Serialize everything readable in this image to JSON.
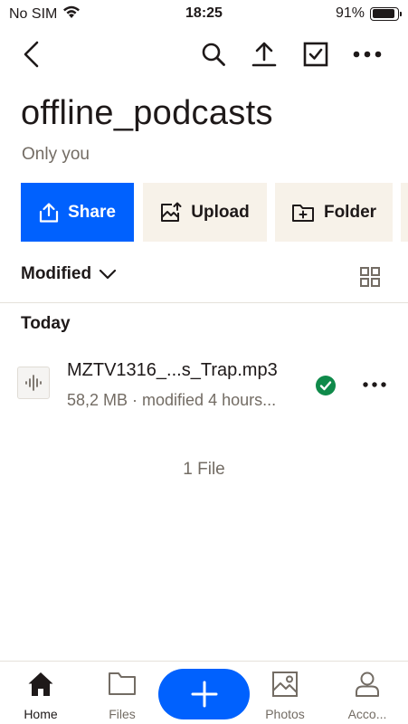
{
  "status_bar": {
    "carrier": "No SIM",
    "time": "18:25",
    "battery": "91%",
    "battery_level": 0.91
  },
  "toolbar": {
    "icons": [
      "back-icon",
      "search-icon",
      "upload-icon",
      "select-icon",
      "more-icon"
    ]
  },
  "header": {
    "title": "offline_podcasts",
    "subtitle": "Only you"
  },
  "actions": {
    "share_label": "Share",
    "upload_label": "Upload",
    "folder_label": "Folder"
  },
  "sort": {
    "label": "Modified"
  },
  "sections": [
    {
      "title": "Today",
      "files": [
        {
          "name": "MZTV1316_...s_Trap.mp3",
          "meta": "58,2 MB · modified 4 hours...",
          "synced": true
        }
      ]
    }
  ],
  "footer": {
    "file_count": "1 File"
  },
  "tabbar": {
    "tabs": [
      {
        "label": "Home",
        "active": true
      },
      {
        "label": "Files",
        "active": false
      },
      {
        "label": "Photos",
        "active": false
      },
      {
        "label": "Acco...",
        "active": false
      }
    ]
  },
  "colors": {
    "accent": "#0061fe",
    "secondary_button": "#f7f2e9",
    "text": "#1e1919",
    "muted_text": "#736c64",
    "synced_green": "#0f8a4a"
  }
}
